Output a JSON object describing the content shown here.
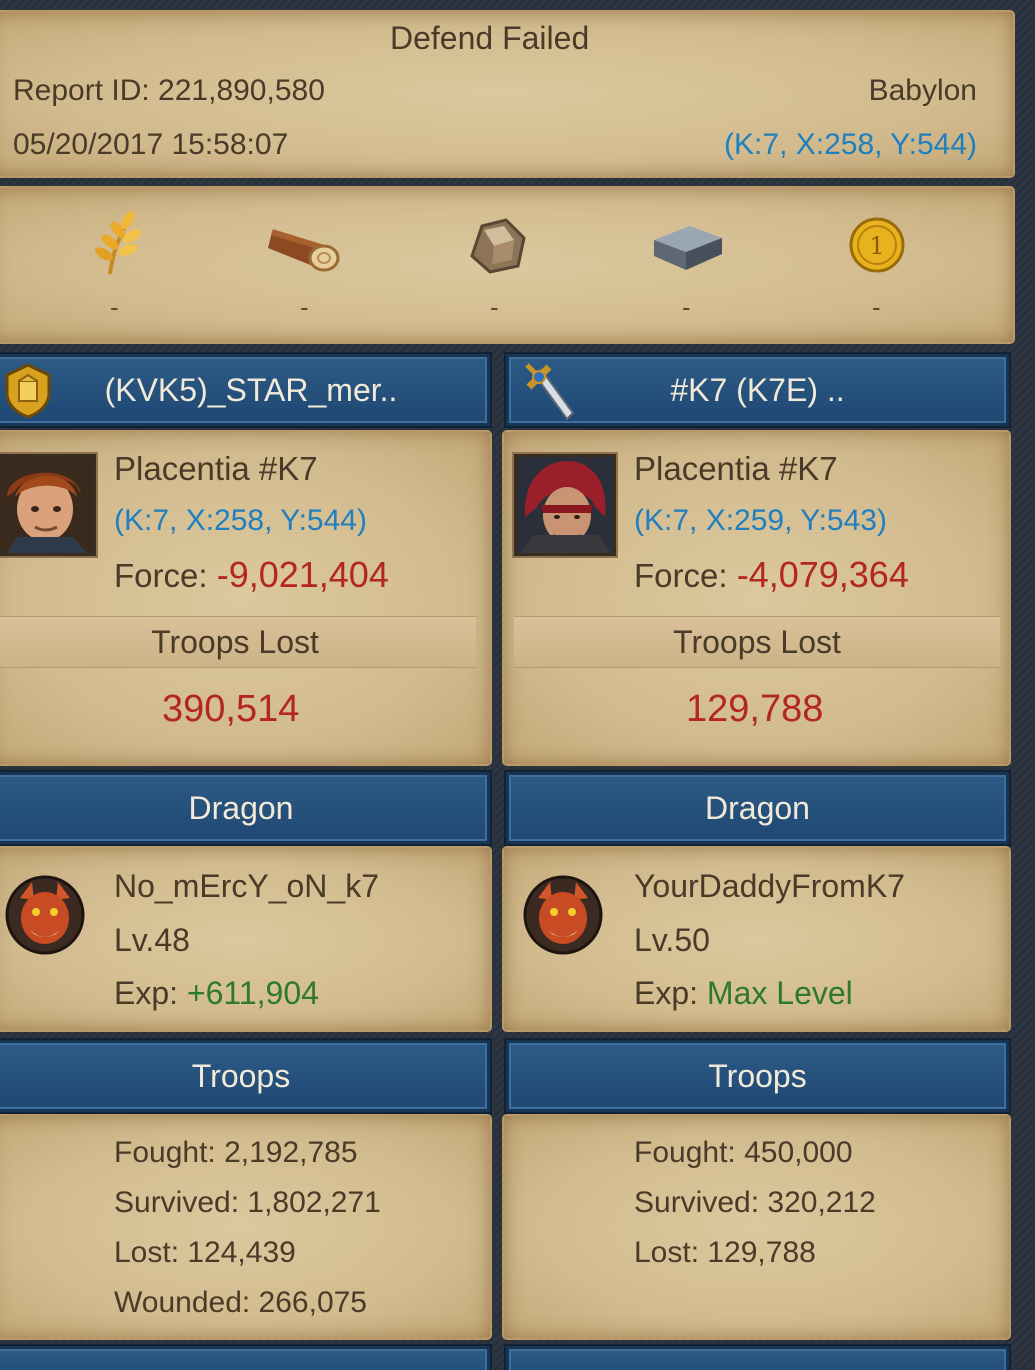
{
  "report": {
    "title": "Defend Failed",
    "report_id": "Report ID: 221,890,580",
    "datetime": "05/20/2017 15:58:07",
    "location_name": "Babylon",
    "location_coords": "(K:7, X:258, Y:544)"
  },
  "resources": [
    {
      "icon": "wheat-icon",
      "value": "-"
    },
    {
      "icon": "wood-log-icon",
      "value": "-"
    },
    {
      "icon": "stone-icon",
      "value": "-"
    },
    {
      "icon": "iron-ingot-icon",
      "value": "-"
    },
    {
      "icon": "gold-coin-icon",
      "value": "-"
    }
  ],
  "left": {
    "banner_name": "(KVK5)_STAR_mer..",
    "banner_icon": "shield-icon",
    "player_name": "Placentia #K7",
    "coords": "(K:7, X:258, Y:544)",
    "force_label": "Force:",
    "force_value": "-9,021,404",
    "troops_lost_label": "Troops Lost",
    "troops_lost_value": "390,514",
    "dragon_header": "Dragon",
    "dragon_name": "No_mErcY_oN_k7",
    "dragon_level": "Lv.48",
    "exp_label": "Exp:",
    "exp_value": "+611,904",
    "troops_header": "Troops",
    "fought": "Fought: 2,192,785",
    "survived": "Survived: 1,802,271",
    "lost": "Lost: 124,439",
    "wounded": "Wounded: 266,075"
  },
  "right": {
    "banner_name": "#K7 (K7E) ..",
    "banner_icon": "sword-icon",
    "player_name": "Placentia #K7",
    "coords": "(K:7, X:259, Y:543)",
    "force_label": "Force:",
    "force_value": "-4,079,364",
    "troops_lost_label": "Troops Lost",
    "troops_lost_value": "129,788",
    "dragon_header": "Dragon",
    "dragon_name": "YourDaddyFromK7",
    "dragon_level": "Lv.50",
    "exp_label": "Exp:",
    "exp_value": "Max Level",
    "troops_header": "Troops",
    "fought": "Fought: 450,000",
    "survived": "Survived: 320,212",
    "lost": "Lost: 129,788"
  },
  "colors": {
    "banner_blue": "#234f7a",
    "parchment": "#d6bf93",
    "coord_blue": "#1f7fbf",
    "loss_red": "#b3271d",
    "exp_green": "#2f7a2a"
  }
}
